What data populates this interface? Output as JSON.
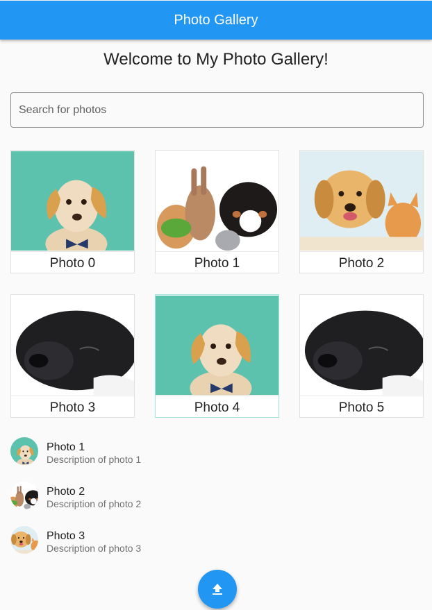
{
  "appbar": {
    "title": "Photo Gallery",
    "color": "#2196f3"
  },
  "welcome": "Welcome to My Photo Gallery!",
  "search": {
    "placeholder": "Search for photos",
    "value": ""
  },
  "grid": [
    {
      "caption": "Photo 0",
      "image": "dog-on-teal"
    },
    {
      "caption": "Photo 1",
      "image": "pets-group"
    },
    {
      "caption": "Photo 2",
      "image": "puppy-and-kitten"
    },
    {
      "caption": "Photo 3",
      "image": "sleeping-black-dog"
    },
    {
      "caption": "Photo 4",
      "image": "dog-on-teal"
    },
    {
      "caption": "Photo 5",
      "image": "sleeping-black-dog"
    }
  ],
  "list": [
    {
      "title": "Photo 1",
      "subtitle": "Description of photo 1",
      "image": "dog-on-teal"
    },
    {
      "title": "Photo 2",
      "subtitle": "Description of photo 2",
      "image": "pets-group"
    },
    {
      "title": "Photo 3",
      "subtitle": "Description of photo 3",
      "image": "puppy-and-kitten"
    }
  ],
  "fab": {
    "icon": "upload-icon"
  }
}
